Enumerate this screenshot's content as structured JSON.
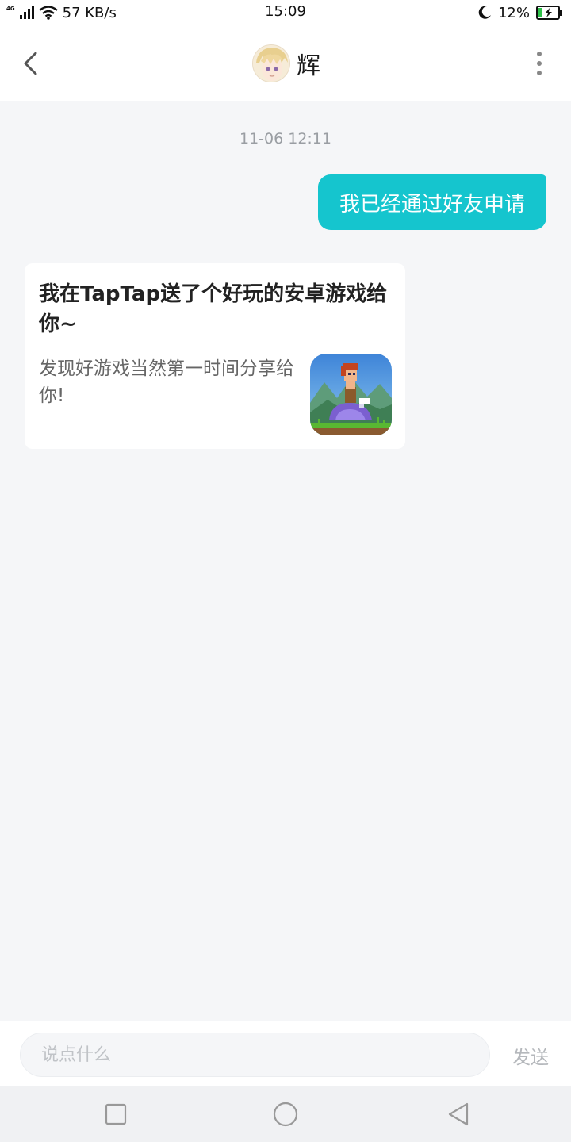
{
  "status_bar": {
    "network": "4G",
    "speed": "57 KB/s",
    "time": "15:09",
    "battery": "12%"
  },
  "header": {
    "contact_name": "辉"
  },
  "chat": {
    "timestamp": "11-06 12:11",
    "outgoing_message": "我已经通过好友申请",
    "share_card": {
      "title": "我在TapTap送了个好玩的安卓游戏给你~",
      "description": "发现好游戏当然第一时间分享给你!"
    }
  },
  "input_bar": {
    "placeholder": "说点什么",
    "send_label": "发送"
  },
  "colors": {
    "accent": "#15c5ce",
    "background": "#f5f6f8"
  }
}
